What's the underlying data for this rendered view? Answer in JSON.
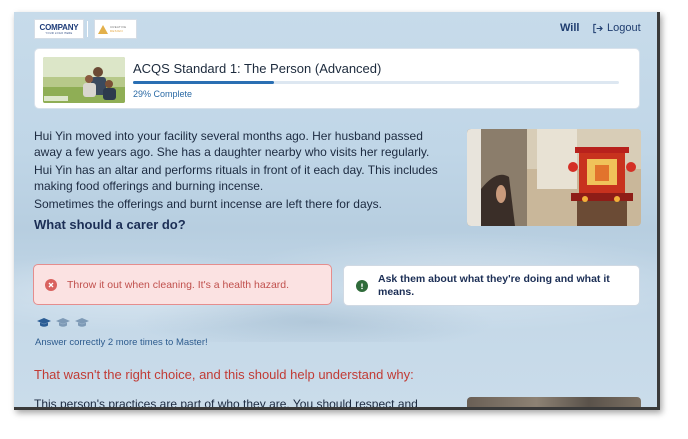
{
  "header": {
    "logo_company": "COMPANY",
    "logo_company_tagline": "YOUR LOGO HERE",
    "logo_creative_top": "CREATIVE",
    "logo_creative_bottom": "DESIGN",
    "user_name": "Will",
    "logout_label": "Logout"
  },
  "course": {
    "title": "ACQS Standard 1: The Person (Advanced)",
    "progress_percent": 29,
    "progress_label": "29% Complete"
  },
  "story": {
    "paragraphs": [
      "Hui Yin moved into your facility several months ago. Her husband passed away a few years ago. She has a daughter nearby who visits her regularly.",
      "Hui Yin has an altar and performs rituals in front of it each day. This includes making food offerings and burning incense.",
      "Sometimes the offerings and burnt incense are left there for days."
    ],
    "question": "What should a carer do?"
  },
  "answers": {
    "wrong": {
      "text": "Throw it out when cleaning. It's a health hazard.",
      "icon": "x-circle-icon",
      "color": "#c0504d"
    },
    "right": {
      "text": "Ask them about what they're doing and what it means.",
      "icon": "exclamation-circle-icon",
      "color": "#2f6b3a"
    }
  },
  "mastery": {
    "caps_total": 3,
    "caps_earned": 1,
    "message": "Answer correctly 2 more times to Master!"
  },
  "feedback": {
    "title": "That wasn't the right choice, and this should help understand why:",
    "text": "This person's practices are part of who they are. You should respect and"
  },
  "colors": {
    "accent": "#2a6fb3",
    "navy": "#1b2e55",
    "error": "#c13b35"
  }
}
